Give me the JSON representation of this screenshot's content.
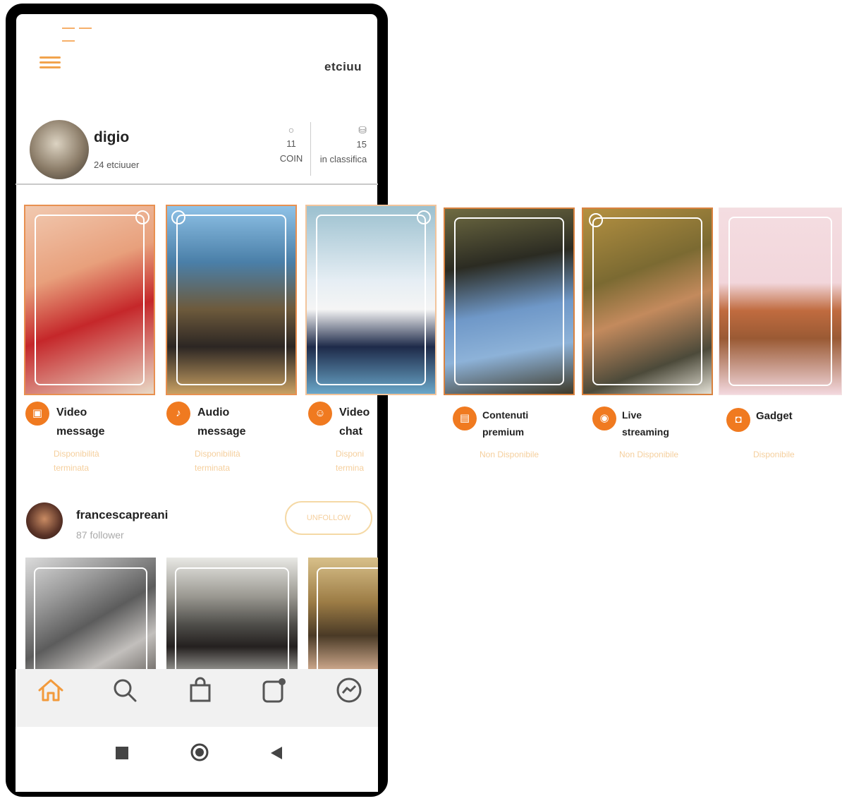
{
  "header": {
    "logo": "etciuu",
    "menu_icon": "hamburger-menu-icon"
  },
  "profile": {
    "username": "digio",
    "follower_text": "24 etciuuer",
    "stats": [
      {
        "icon": "coin-icon",
        "value": "11",
        "label": "COIN"
      },
      {
        "icon": "trophy-icon",
        "value": "15",
        "label": "in classifica"
      }
    ]
  },
  "services": [
    {
      "icon": "video-message-icon",
      "title_line1": "Video",
      "title_line2": "message",
      "status_line1": "Disponibilità",
      "status_line2": "terminata"
    },
    {
      "icon": "microphone-icon",
      "title_line1": "Audio",
      "title_line2": "message",
      "status_line1": "Disponibilità",
      "status_line2": "terminata"
    },
    {
      "icon": "video-chat-icon",
      "title_line1": "Video",
      "title_line2": "chat",
      "status_line1": "Disponi",
      "status_line2": "termina"
    },
    {
      "icon": "premium-content-icon",
      "title_line1": "Contenuti",
      "title_line2": "premium",
      "status_line1": "Non Disponibile",
      "status_line2": ""
    },
    {
      "icon": "live-streaming-icon",
      "title_line1": "Live",
      "title_line2": "streaming",
      "status_line1": "Non Disponibile",
      "status_line2": ""
    },
    {
      "icon": "gadget-bag-icon",
      "title_line1": "Gadget",
      "title_line2": "",
      "status_line1": "Disponibile",
      "status_line2": ""
    }
  ],
  "suggested_user": {
    "username": "francescapreani",
    "followers": "87 follower",
    "button_label": "UNFOLLOW"
  },
  "bottom_nav": [
    "home-icon",
    "search-icon",
    "shopping-bag-icon",
    "notifications-icon",
    "messenger-icon"
  ],
  "system_nav": [
    "recents-square-icon",
    "home-circle-icon",
    "back-triangle-icon"
  ],
  "colors": {
    "accent": "#f07a20",
    "accent_light": "#f5cf9d",
    "menu": "#f1a34d"
  }
}
